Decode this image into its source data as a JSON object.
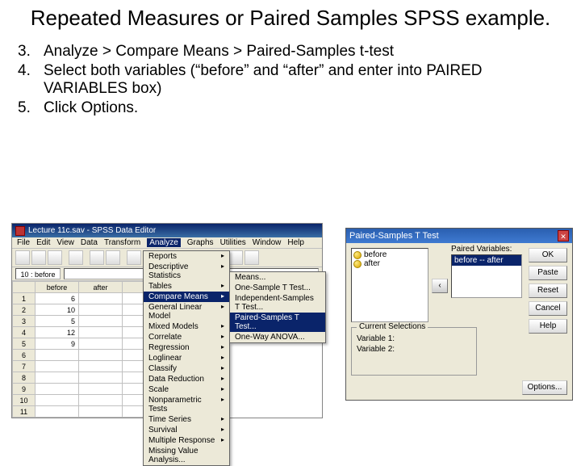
{
  "slide": {
    "title": "Repeated Measures or Paired Samples SPSS example."
  },
  "steps": [
    {
      "num": "3.",
      "text": "Analyze > Compare Means > Paired-Samples t-test"
    },
    {
      "num": "4.",
      "text": "Select both variables (“before” and “after” and enter into PAIRED VARIABLES box)"
    },
    {
      "num": "5.",
      "text": "Click Options."
    }
  ],
  "editor": {
    "title": "Lecture 11c.sav - SPSS Data Editor",
    "menubar": [
      "File",
      "Edit",
      "View",
      "Data",
      "Transform",
      "Analyze",
      "Graphs",
      "Utilities",
      "Window",
      "Help"
    ],
    "menubar_highlight_index": 5,
    "cell_ref": "10 : before",
    "columns": [
      "before",
      "after"
    ],
    "rows": [
      {
        "n": "1",
        "before": "6",
        "after": ""
      },
      {
        "n": "2",
        "before": "10",
        "after": ""
      },
      {
        "n": "3",
        "before": "5",
        "after": ""
      },
      {
        "n": "4",
        "before": "12",
        "after": ""
      },
      {
        "n": "5",
        "before": "9",
        "after": ""
      },
      {
        "n": "6",
        "before": "",
        "after": ""
      },
      {
        "n": "7",
        "before": "",
        "after": ""
      },
      {
        "n": "8",
        "before": "",
        "after": ""
      },
      {
        "n": "9",
        "before": "",
        "after": ""
      },
      {
        "n": "10",
        "before": "",
        "after": ""
      },
      {
        "n": "11",
        "before": "",
        "after": ""
      }
    ]
  },
  "analyze_menu": {
    "items": [
      "Reports",
      "Descriptive Statistics",
      "Tables",
      "Compare Means",
      "General Linear Model",
      "Mixed Models",
      "Correlate",
      "Regression",
      "Loglinear",
      "Classify",
      "Data Reduction",
      "Scale",
      "Nonparametric Tests",
      "Time Series",
      "Survival",
      "Multiple Response",
      "Missing Value Analysis..."
    ],
    "highlight_index": 3
  },
  "compare_submenu": {
    "items": [
      "Means...",
      "One-Sample T Test...",
      "Independent-Samples T Test...",
      "Paired-Samples T Test...",
      "One-Way ANOVA..."
    ],
    "highlight_index": 3
  },
  "dialog": {
    "title": "Paired-Samples T Test",
    "source_vars": [
      "before",
      "after"
    ],
    "paired_label": "Paired Variables:",
    "paired_row": "before   -- after",
    "move_label": "‹",
    "buttons": {
      "ok": "OK",
      "paste": "Paste",
      "reset": "Reset",
      "cancel": "Cancel",
      "help": "Help",
      "options": "Options..."
    },
    "current_selections": {
      "legend": "Current Selections",
      "v1": "Variable 1:",
      "v2": "Variable 2:"
    }
  }
}
